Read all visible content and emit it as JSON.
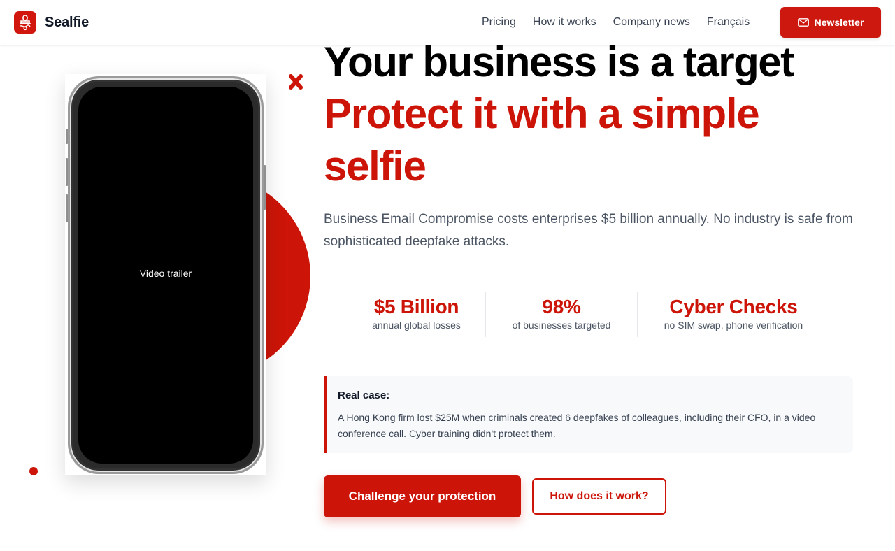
{
  "header": {
    "brand_name": "Sealfie",
    "logo_icon": "stamp-icon",
    "nav": [
      {
        "label": "Pricing"
      },
      {
        "label": "How it works"
      },
      {
        "label": "Company news"
      },
      {
        "label": "Français"
      }
    ],
    "newsletter_label": "Newsletter",
    "newsletter_icon": "mail-icon"
  },
  "media": {
    "video_label": "Video trailer"
  },
  "hero": {
    "headline_line1": "Your business is a target",
    "headline_line2": "Protect it with a simple selfie",
    "subtitle": "Business Email Compromise costs enterprises $5 billion annually. No industry is safe from sophisticated deepfake attacks."
  },
  "stats": [
    {
      "value": "$5 Billion",
      "label": "annual global losses"
    },
    {
      "value": "98%",
      "label": "of businesses targeted"
    },
    {
      "value": "Cyber Checks",
      "label": "no SIM swap, phone verification"
    }
  ],
  "case": {
    "title": "Real case:",
    "text": "A Hong Kong firm lost $25M when criminals created 6 deepfakes of colleagues, including their CFO, in a video conference call. Cyber training didn't protect them."
  },
  "cta": {
    "primary_label": "Challenge your protection",
    "secondary_label": "How does it work?"
  },
  "colors": {
    "accent": "#cc1508",
    "text_dark": "#111827",
    "text_muted": "#4b5563"
  }
}
